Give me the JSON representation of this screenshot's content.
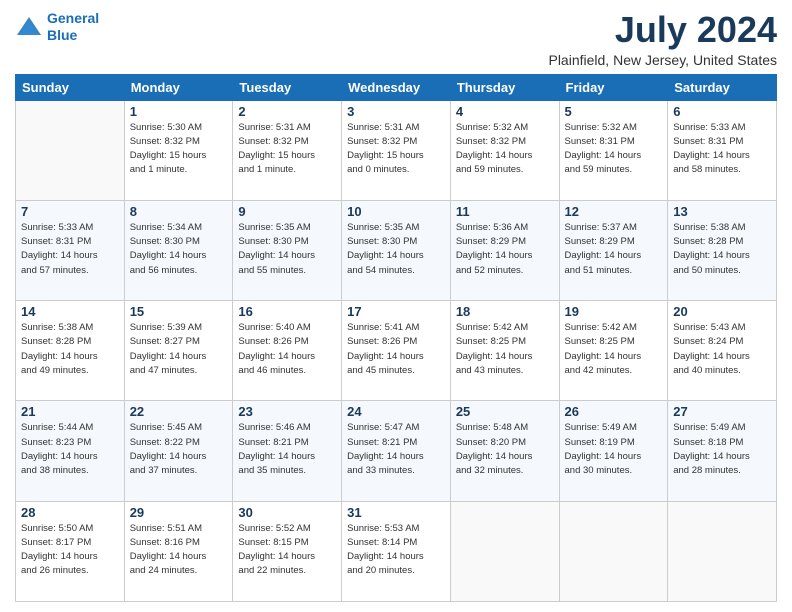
{
  "logo": {
    "line1": "General",
    "line2": "Blue"
  },
  "title": "July 2024",
  "subtitle": "Plainfield, New Jersey, United States",
  "weekdays": [
    "Sunday",
    "Monday",
    "Tuesday",
    "Wednesday",
    "Thursday",
    "Friday",
    "Saturday"
  ],
  "weeks": [
    [
      {
        "day": "",
        "info": ""
      },
      {
        "day": "1",
        "info": "Sunrise: 5:30 AM\nSunset: 8:32 PM\nDaylight: 15 hours\nand 1 minute."
      },
      {
        "day": "2",
        "info": "Sunrise: 5:31 AM\nSunset: 8:32 PM\nDaylight: 15 hours\nand 1 minute."
      },
      {
        "day": "3",
        "info": "Sunrise: 5:31 AM\nSunset: 8:32 PM\nDaylight: 15 hours\nand 0 minutes."
      },
      {
        "day": "4",
        "info": "Sunrise: 5:32 AM\nSunset: 8:32 PM\nDaylight: 14 hours\nand 59 minutes."
      },
      {
        "day": "5",
        "info": "Sunrise: 5:32 AM\nSunset: 8:31 PM\nDaylight: 14 hours\nand 59 minutes."
      },
      {
        "day": "6",
        "info": "Sunrise: 5:33 AM\nSunset: 8:31 PM\nDaylight: 14 hours\nand 58 minutes."
      }
    ],
    [
      {
        "day": "7",
        "info": "Sunrise: 5:33 AM\nSunset: 8:31 PM\nDaylight: 14 hours\nand 57 minutes."
      },
      {
        "day": "8",
        "info": "Sunrise: 5:34 AM\nSunset: 8:30 PM\nDaylight: 14 hours\nand 56 minutes."
      },
      {
        "day": "9",
        "info": "Sunrise: 5:35 AM\nSunset: 8:30 PM\nDaylight: 14 hours\nand 55 minutes."
      },
      {
        "day": "10",
        "info": "Sunrise: 5:35 AM\nSunset: 8:30 PM\nDaylight: 14 hours\nand 54 minutes."
      },
      {
        "day": "11",
        "info": "Sunrise: 5:36 AM\nSunset: 8:29 PM\nDaylight: 14 hours\nand 52 minutes."
      },
      {
        "day": "12",
        "info": "Sunrise: 5:37 AM\nSunset: 8:29 PM\nDaylight: 14 hours\nand 51 minutes."
      },
      {
        "day": "13",
        "info": "Sunrise: 5:38 AM\nSunset: 8:28 PM\nDaylight: 14 hours\nand 50 minutes."
      }
    ],
    [
      {
        "day": "14",
        "info": "Sunrise: 5:38 AM\nSunset: 8:28 PM\nDaylight: 14 hours\nand 49 minutes."
      },
      {
        "day": "15",
        "info": "Sunrise: 5:39 AM\nSunset: 8:27 PM\nDaylight: 14 hours\nand 47 minutes."
      },
      {
        "day": "16",
        "info": "Sunrise: 5:40 AM\nSunset: 8:26 PM\nDaylight: 14 hours\nand 46 minutes."
      },
      {
        "day": "17",
        "info": "Sunrise: 5:41 AM\nSunset: 8:26 PM\nDaylight: 14 hours\nand 45 minutes."
      },
      {
        "day": "18",
        "info": "Sunrise: 5:42 AM\nSunset: 8:25 PM\nDaylight: 14 hours\nand 43 minutes."
      },
      {
        "day": "19",
        "info": "Sunrise: 5:42 AM\nSunset: 8:25 PM\nDaylight: 14 hours\nand 42 minutes."
      },
      {
        "day": "20",
        "info": "Sunrise: 5:43 AM\nSunset: 8:24 PM\nDaylight: 14 hours\nand 40 minutes."
      }
    ],
    [
      {
        "day": "21",
        "info": "Sunrise: 5:44 AM\nSunset: 8:23 PM\nDaylight: 14 hours\nand 38 minutes."
      },
      {
        "day": "22",
        "info": "Sunrise: 5:45 AM\nSunset: 8:22 PM\nDaylight: 14 hours\nand 37 minutes."
      },
      {
        "day": "23",
        "info": "Sunrise: 5:46 AM\nSunset: 8:21 PM\nDaylight: 14 hours\nand 35 minutes."
      },
      {
        "day": "24",
        "info": "Sunrise: 5:47 AM\nSunset: 8:21 PM\nDaylight: 14 hours\nand 33 minutes."
      },
      {
        "day": "25",
        "info": "Sunrise: 5:48 AM\nSunset: 8:20 PM\nDaylight: 14 hours\nand 32 minutes."
      },
      {
        "day": "26",
        "info": "Sunrise: 5:49 AM\nSunset: 8:19 PM\nDaylight: 14 hours\nand 30 minutes."
      },
      {
        "day": "27",
        "info": "Sunrise: 5:49 AM\nSunset: 8:18 PM\nDaylight: 14 hours\nand 28 minutes."
      }
    ],
    [
      {
        "day": "28",
        "info": "Sunrise: 5:50 AM\nSunset: 8:17 PM\nDaylight: 14 hours\nand 26 minutes."
      },
      {
        "day": "29",
        "info": "Sunrise: 5:51 AM\nSunset: 8:16 PM\nDaylight: 14 hours\nand 24 minutes."
      },
      {
        "day": "30",
        "info": "Sunrise: 5:52 AM\nSunset: 8:15 PM\nDaylight: 14 hours\nand 22 minutes."
      },
      {
        "day": "31",
        "info": "Sunrise: 5:53 AM\nSunset: 8:14 PM\nDaylight: 14 hours\nand 20 minutes."
      },
      {
        "day": "",
        "info": ""
      },
      {
        "day": "",
        "info": ""
      },
      {
        "day": "",
        "info": ""
      }
    ]
  ]
}
